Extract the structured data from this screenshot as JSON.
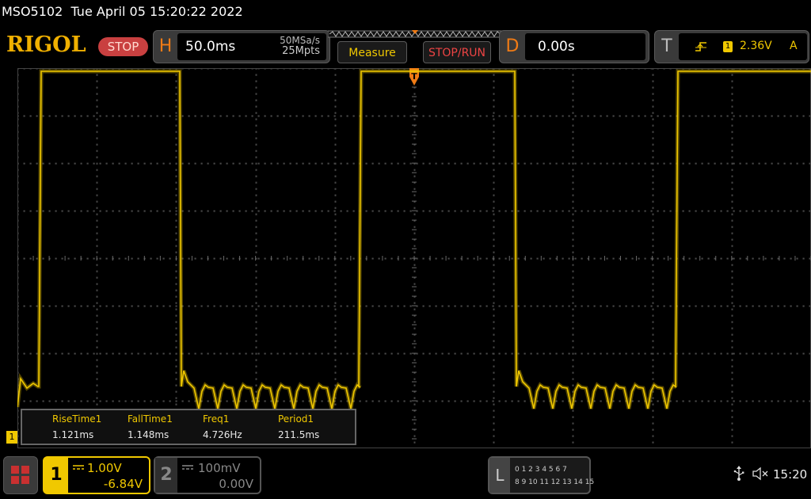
{
  "title_bar": {
    "model": "MSO5102",
    "datetime": "Tue April 05 15:20:22 2022"
  },
  "brand": {
    "logo": "RIGOL",
    "run_state": "STOP"
  },
  "horizontal": {
    "tag": "H",
    "timebase": "50.0ms",
    "sample_rate": "50MSa/s",
    "memory_depth": "25Mpts"
  },
  "buttons": {
    "measure": "Measure",
    "stop_run": "STOP/RUN"
  },
  "delay": {
    "tag": "D",
    "value": "0.00s"
  },
  "trigger": {
    "tag": "T",
    "slope_icon": "rising-edge-icon",
    "channel": "1",
    "level": "2.36V",
    "mode": "A"
  },
  "measurements": [
    {
      "name": "RiseTime1",
      "value": "1.121ms"
    },
    {
      "name": "FallTime1",
      "value": "1.148ms"
    },
    {
      "name": "Freq1",
      "value": "4.726Hz"
    },
    {
      "name": "Period1",
      "value": "211.5ms"
    }
  ],
  "channel1": {
    "number": "1",
    "scale": "1.00V",
    "offset": "-6.84V",
    "color": "#f0c800",
    "marker": "1"
  },
  "channel2": {
    "number": "2",
    "scale": "100mV",
    "offset": "0.00V",
    "color": "#888888"
  },
  "logic": {
    "tag": "L",
    "row1": "0 1 2 3   4 5 6 7",
    "row2": "8 9 10 11 12 13 14 15"
  },
  "status": {
    "time": "15:20",
    "usb_icon": "usb-icon",
    "sound_icon": "speaker-muted-icon"
  },
  "colors": {
    "trace": "#f0c800",
    "grid": "#555555",
    "accent": "#f07b15",
    "run_stop": "#ee4444"
  }
}
